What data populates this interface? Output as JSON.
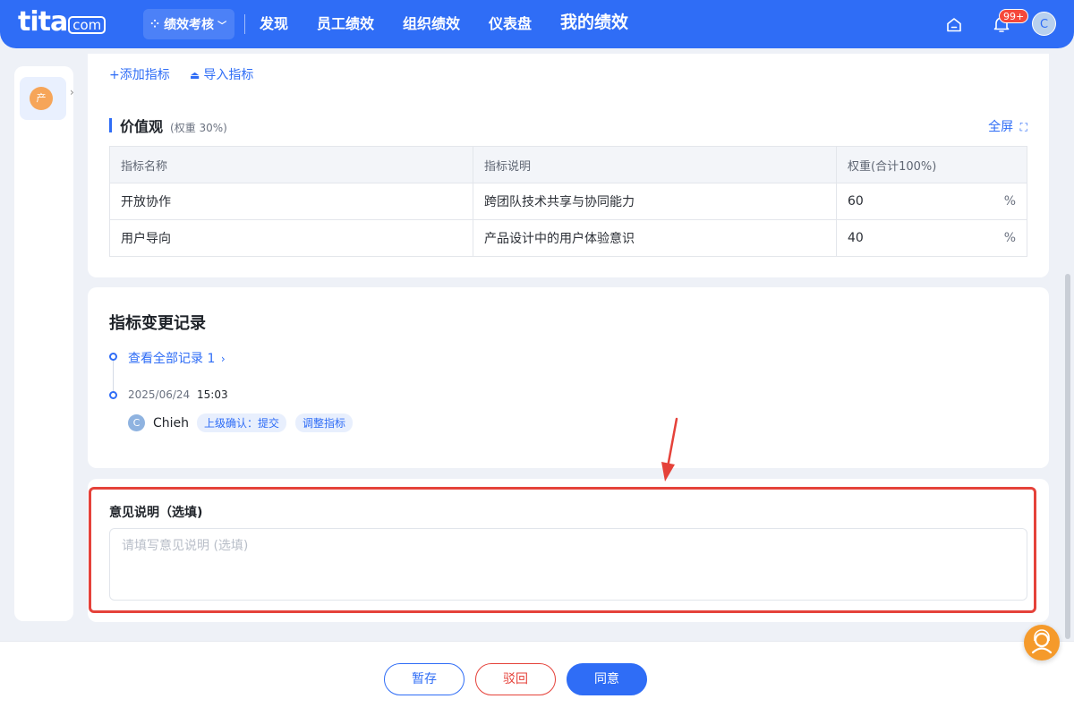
{
  "header": {
    "logo_main": "tita",
    "logo_suffix": "com",
    "module_label": "绩效考核",
    "nav": [
      "发现",
      "员工绩效",
      "组织绩效",
      "仪表盘",
      "我的绩效"
    ],
    "notification_count": "99+",
    "user_initial": "C"
  },
  "sidebar": {
    "item_initial": "产"
  },
  "indicators": {
    "add_label": "+添加指标",
    "import_label": "导入指标",
    "section_title": "价值观",
    "section_weight": "(权重 30%)",
    "fullscreen_label": "全屏",
    "columns": [
      "指标名称",
      "指标说明",
      "权重(合计100%)"
    ],
    "rows": [
      {
        "name": "开放协作",
        "desc": "跨团队技术共享与协同能力",
        "weight": "60",
        "unit": "%"
      },
      {
        "name": "用户导向",
        "desc": "产品设计中的用户体验意识",
        "weight": "40",
        "unit": "%"
      }
    ]
  },
  "change_log": {
    "title": "指标变更记录",
    "view_all": "查看全部记录 1",
    "date": "2025/06/24",
    "time": "15:03",
    "user_initial": "C",
    "user_name": "Chieh",
    "tags": [
      "上级确认：提交",
      "调整指标"
    ]
  },
  "opinion": {
    "label": "意见说明（选填)",
    "placeholder": "请填写意见说明 (选填)"
  },
  "footer": {
    "save": "暂存",
    "reject": "驳回",
    "agree": "同意"
  },
  "colors": {
    "primary": "#2f6df6",
    "danger": "#e5423a",
    "accent_orange": "#f59a2b"
  }
}
